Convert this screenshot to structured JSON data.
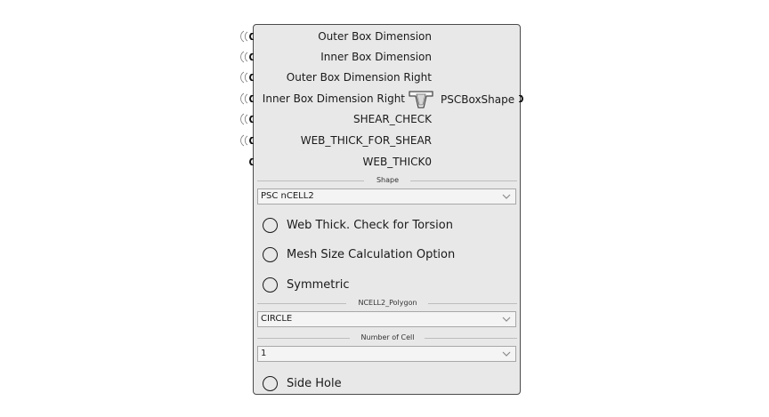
{
  "component": {
    "inputs": [
      {
        "label": "Outer Box Dimension",
        "wired": true
      },
      {
        "label": "Inner Box Dimension",
        "wired": true
      },
      {
        "label": "Outer Box Dimension Right",
        "wired": true
      },
      {
        "label": "Inner Box Dimension Right",
        "wired": true
      },
      {
        "label": "SHEAR_CHECK",
        "wired": true
      },
      {
        "label": "WEB_THICK_FOR_SHEAR",
        "wired": true
      },
      {
        "label": "WEB_THICK0",
        "wired": false
      }
    ],
    "icon": "psc-box-shape-icon",
    "output": {
      "label": "PSCBoxShape"
    },
    "shape_section": {
      "title": "Shape",
      "selected": "PSC nCELL2"
    },
    "options": [
      {
        "label": "Web Thick. Check for Torsion",
        "checked": false
      },
      {
        "label": "Mesh Size Calculation Option",
        "checked": false
      },
      {
        "label": "Symmetric",
        "checked": false
      }
    ],
    "polygon_section": {
      "title": "NCELL2_Polygon",
      "selected": "CIRCLE"
    },
    "cell_section": {
      "title": "Number of Cell",
      "selected": "1"
    },
    "side_hole": {
      "label": "Side Hole",
      "checked": false
    }
  }
}
